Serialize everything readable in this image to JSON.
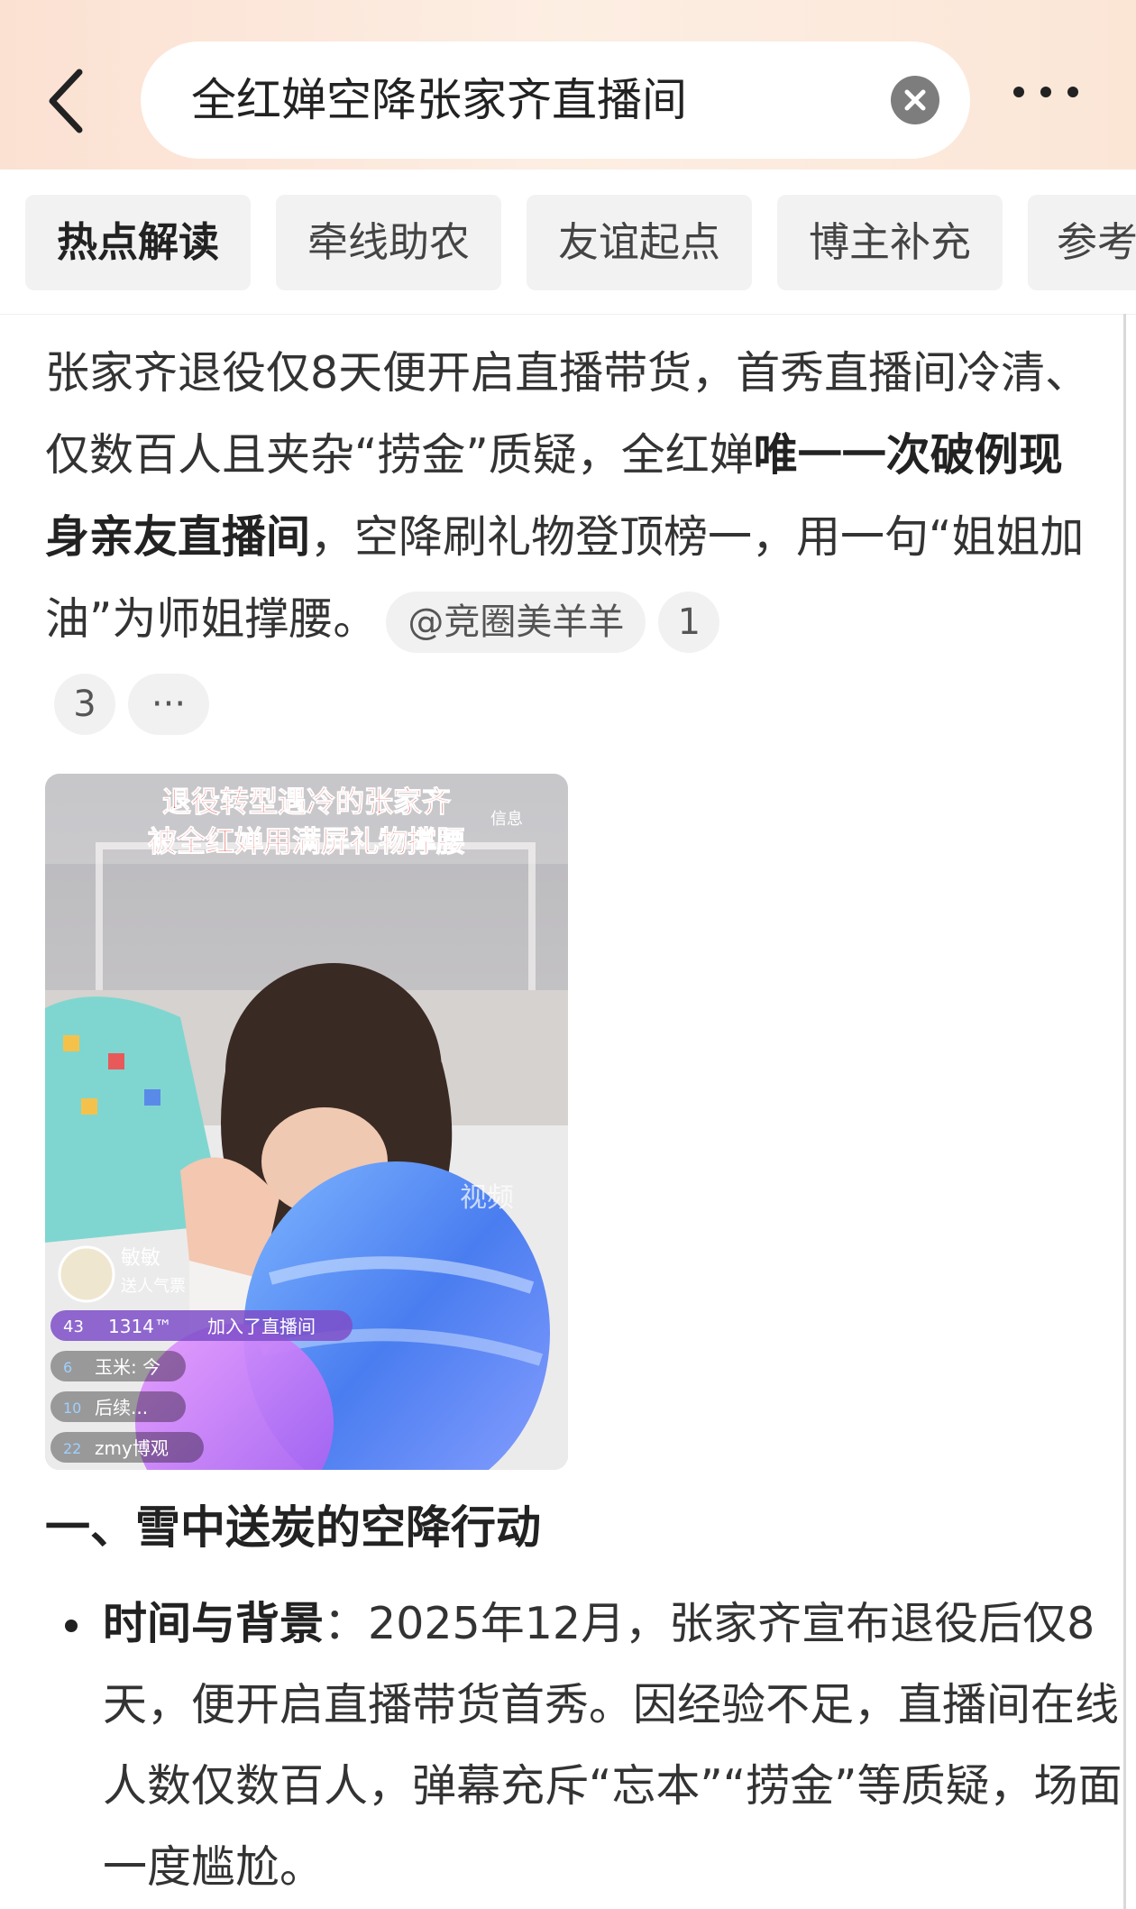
{
  "search": {
    "query": "全红婵空降张家齐直播间"
  },
  "tabs": [
    {
      "label": "热点解读",
      "active": true
    },
    {
      "label": "牵线助农",
      "active": false
    },
    {
      "label": "友谊起点",
      "active": false
    },
    {
      "label": "博主补充",
      "active": false
    },
    {
      "label": "参考",
      "active": false
    }
  ],
  "summary": {
    "text_before": "张家齐退役仅8天便开启直播带货，首秀直播间冷清、仅数百人且夹杂“捞金”质疑，全红婵",
    "bold_text": "唯一一次破例现身亲友直播间",
    "text_after": "，空降刷礼物登顶榜一，用一句“姐姐加油”为师姐撑腰。",
    "source_chip": "@竞圈美羊羊",
    "ref_chips": [
      "1",
      "3"
    ],
    "more_chip": "···"
  },
  "image": {
    "caption_line1": "退役转型遇冷的张家齐",
    "caption_line2": "被全红婵用满屏礼物撑腰",
    "overlay_corner": "信息",
    "watermark": "视频",
    "gift_user_name": "敏敏",
    "gift_user_sub": "送人气票",
    "join_badge": "43",
    "join_user": "1314™",
    "join_text": "加入了直播间",
    "chat": [
      {
        "level": "6",
        "text": "玉米: 今"
      },
      {
        "level": "10",
        "text": "后续..."
      },
      {
        "level": "22",
        "text": "zmy博观"
      }
    ]
  },
  "section": {
    "title": "一、雪中送炭的空降行动"
  },
  "bullet": {
    "label": "时间与背景",
    "colon": "：",
    "text": "2025年12月，张家齐宣布退役后仅8天，便开启直播带货首秀。因经验不足，直播间在线人数仅数百人，弹幕充斥“忘本”“捞金”等质疑，场面一度尴尬。"
  },
  "colors": {
    "topbar_start": "#fbe1d2",
    "caption_red": "#d8332e",
    "chip_bg": "#f1f1f1"
  }
}
